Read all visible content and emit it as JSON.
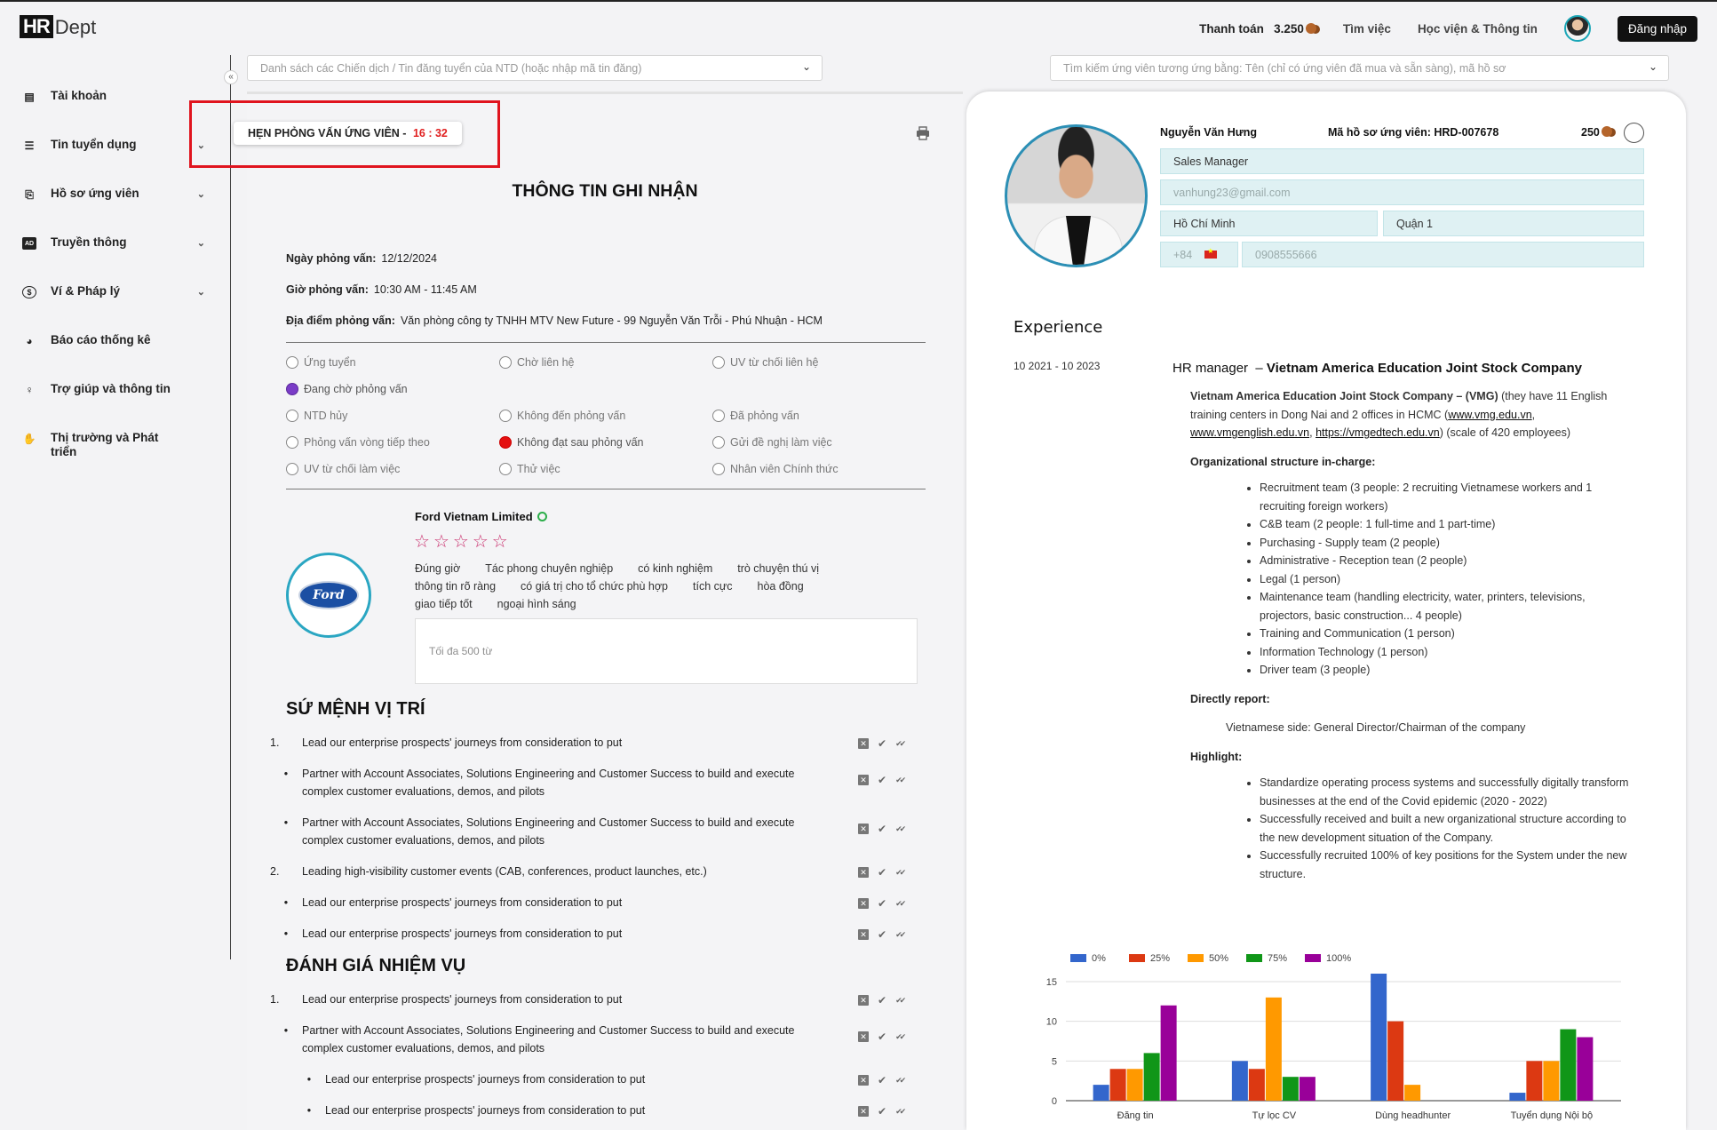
{
  "app": {
    "logo_hr": "HR",
    "logo_dept": "Dept"
  },
  "topnav": {
    "payment_label": "Thanh toán",
    "payment_amount": "3.250",
    "jobs": "Tìm việc",
    "academy": "Học viện & Thông tin",
    "login": "Đăng nhập"
  },
  "sidebar": {
    "items": [
      {
        "label": "Tài khoản",
        "icon": "id-card-icon",
        "has_chevron": false
      },
      {
        "label": "Tin tuyển dụng",
        "icon": "list-icon",
        "has_chevron": true
      },
      {
        "label": "Hồ sơ ứng viên",
        "icon": "candidate-icon",
        "has_chevron": true
      },
      {
        "label": "Truyền thông",
        "icon": "ad-icon",
        "has_chevron": true
      },
      {
        "label": "Ví & Pháp lý",
        "icon": "dollar-icon",
        "has_chevron": true
      },
      {
        "label": "Báo cáo thống kê",
        "icon": "pie-chart-icon",
        "has_chevron": false
      },
      {
        "label": "Trợ giúp và thông tin",
        "icon": "person-icon",
        "has_chevron": false
      },
      {
        "label": "Thị trường và Phát triển",
        "icon": "handshake-icon",
        "has_chevron": false
      }
    ]
  },
  "filters": {
    "campaign_placeholder": "Danh sách các Chiến dịch / Tin đăng tuyển của NTD (hoặc nhập mã tin đăng)",
    "candidate_placeholder": "Tìm kiếm ứng viên tương ứng bằng: Tên (chỉ có ứng viên đã mua và sẵn sàng), mã hồ sơ"
  },
  "interview": {
    "label": "HẸN PHỎNG VẤN ỨNG VIÊN -",
    "countdown": "16 : 32",
    "title": "THÔNG TIN GHI NHẬN",
    "date_label": "Ngày phỏng vấn:",
    "date_value": "12/12/2024",
    "time_label": "Giờ phỏng vấn:",
    "time_value": "10:30 AM -  11:45 AM",
    "location_label": "Địa điểm phỏng vấn:",
    "location_value": "Văn phòng công ty TNHH MTV New Future - 99 Nguyễn Văn Trỗi - Phú Nhuận - HCM"
  },
  "statuses": [
    {
      "label": "Ứng tuyển",
      "state": "none"
    },
    {
      "label": "Chờ liên hệ",
      "state": "none"
    },
    {
      "label": "UV từ chối liên hệ",
      "state": "none"
    },
    {
      "label": "Đang chờ phỏng vấn",
      "state": "purple"
    },
    {
      "label": "NTD hủy",
      "state": "none"
    },
    {
      "label": "Không đến phỏng vấn",
      "state": "none"
    },
    {
      "label": "Đã phỏng vấn",
      "state": "none"
    },
    {
      "label": "Phỏng vấn vòng tiếp theo",
      "state": "none"
    },
    {
      "label": "Không đạt sau phỏng vấn",
      "state": "red"
    },
    {
      "label": "Gửi đề nghị làm việc",
      "state": "none"
    },
    {
      "label": "UV từ chối làm việc",
      "state": "none"
    },
    {
      "label": "Thử việc",
      "state": "none"
    },
    {
      "label": "Nhân viên Chính thức",
      "state": "none"
    }
  ],
  "company": {
    "logo_text": "Ford",
    "name": "Ford Vietnam Limited",
    "rating": 0,
    "rating_max": 5,
    "tags": [
      "Đúng giờ",
      "Tác phong chuyên nghiệp",
      "có kinh nghiệm",
      "trò chuyện thú vị",
      "thông tin rõ ràng",
      "có giá trị cho tổ chức phù hợp",
      "tích cực",
      "hòa đồng",
      "giao tiếp tốt",
      "ngoại hình sáng"
    ],
    "comment_placeholder": "Tối đa 500 từ"
  },
  "mission": {
    "title": "SỨ MỆNH VỊ TRÍ",
    "items": [
      {
        "marker": "1.",
        "type": "num",
        "text": "Lead our enterprise prospects' journeys from consideration to put"
      },
      {
        "marker": "•",
        "type": "bul",
        "text": "Partner with Account Associates, Solutions Engineering and Customer Success to build and execute complex customer evaluations, demos, and pilots"
      },
      {
        "marker": "•",
        "type": "bul",
        "text": "Partner with Account Associates, Solutions Engineering and Customer Success to build and execute complex customer evaluations, demos, and pilots"
      },
      {
        "marker": "2.",
        "type": "num",
        "text": "Leading high-visibility customer events (CAB, conferences, product launches, etc.)"
      },
      {
        "marker": "•",
        "type": "bul",
        "text": "Lead our enterprise prospects' journeys from consideration to put"
      },
      {
        "marker": "•",
        "type": "bul",
        "text": "Lead our enterprise prospects' journeys from consideration to put"
      }
    ]
  },
  "evaluation": {
    "title": "ĐÁNH GIÁ NHIỆM VỤ",
    "items": [
      {
        "marker": "1.",
        "type": "num",
        "text": "Lead our enterprise prospects' journeys from consideration to put"
      },
      {
        "marker": "•",
        "type": "bul",
        "text": "Partner with Account Associates, Solutions Engineering and Customer Success to build and execute complex customer evaluations, demos, and pilots"
      },
      {
        "marker": "•",
        "type": "sub",
        "text": "Lead our enterprise prospects' journeys from consideration to put"
      },
      {
        "marker": "•",
        "type": "sub",
        "text": "Lead our enterprise prospects' journeys from consideration to put"
      }
    ]
  },
  "candidate": {
    "name": "Nguyễn Văn Hưng",
    "code_label": "Mã hồ sơ ứng viên: HRD-007678",
    "coins": "250",
    "position": "Sales Manager",
    "email": "vanhung23@gmail.com",
    "city": "Hồ Chí Minh",
    "district": "Quận 1",
    "phone_code": "+84",
    "phone": "0908555666"
  },
  "experience": {
    "heading": "Experience",
    "date": "10 2021 - 10 2023",
    "role": "HR manager",
    "company": "Vietnam America Education Joint Stock Company",
    "org_name": "Vietnam America Education Joint Stock Company – (VMG)",
    "org_desc_1": "(they have 11 English training centers in Dong Nai and 2 offices in HCMC (",
    "link1": "www.vmg.edu.vn",
    "link2": "www.vmgenglish.edu.vn",
    "link3": "https://vmgedtech.edu.vn",
    "org_desc_2": ") (scale of 420 employees)",
    "structure_title": "Organizational structure in-charge:",
    "structure": [
      "Recruitment team (3 people: 2 recruiting Vietnamese workers and 1 recruiting foreign workers)",
      "C&B team (2 people: 1 full-time and 1 part-time)",
      "Purchasing - Supply team (2 people)",
      "Administrative - Reception tean (2 people)",
      "Legal (1 person)",
      "Maintenance team (handling electricity, water, printers, televisions, projectors, basic construction... 4 people)",
      "Training and Communication (1 person)",
      "Information Technology (1 person)",
      "Driver team (3 people)"
    ],
    "report_title": "Directly report:",
    "report_text": "Vietnamese side: General Director/Chairman of the company",
    "highlight_title": "Highlight:",
    "highlights": [
      "Standardize operating process systems and successfully digitally transform businesses at the end of the Covid epidemic (2020 - 2022)",
      "Successfully received and built a new organizational structure according to the new development situation of the Company.",
      "Successfully recruited 100% of key positions for the System under the new structure."
    ]
  },
  "chart_data": {
    "type": "bar",
    "categories": [
      "Đăng tin",
      "Tự lọc CV",
      "Dùng headhunter",
      "Tuyển dụng Nội bộ"
    ],
    "series": [
      {
        "name": "0%",
        "color": "#3366cc",
        "values": [
          2,
          5,
          16,
          1
        ]
      },
      {
        "name": "25%",
        "color": "#dc3912",
        "values": [
          4,
          4,
          10,
          5
        ]
      },
      {
        "name": "50%",
        "color": "#ff9900",
        "values": [
          4,
          13,
          2,
          5
        ]
      },
      {
        "name": "75%",
        "color": "#109618",
        "values": [
          6,
          3,
          0,
          9
        ]
      },
      {
        "name": "100%",
        "color": "#990099",
        "values": [
          12,
          3,
          0,
          8
        ]
      }
    ],
    "yticks": [
      0,
      5,
      10,
      15
    ],
    "ylim": [
      0,
      16
    ],
    "legend": "top-left",
    "grid": true
  }
}
